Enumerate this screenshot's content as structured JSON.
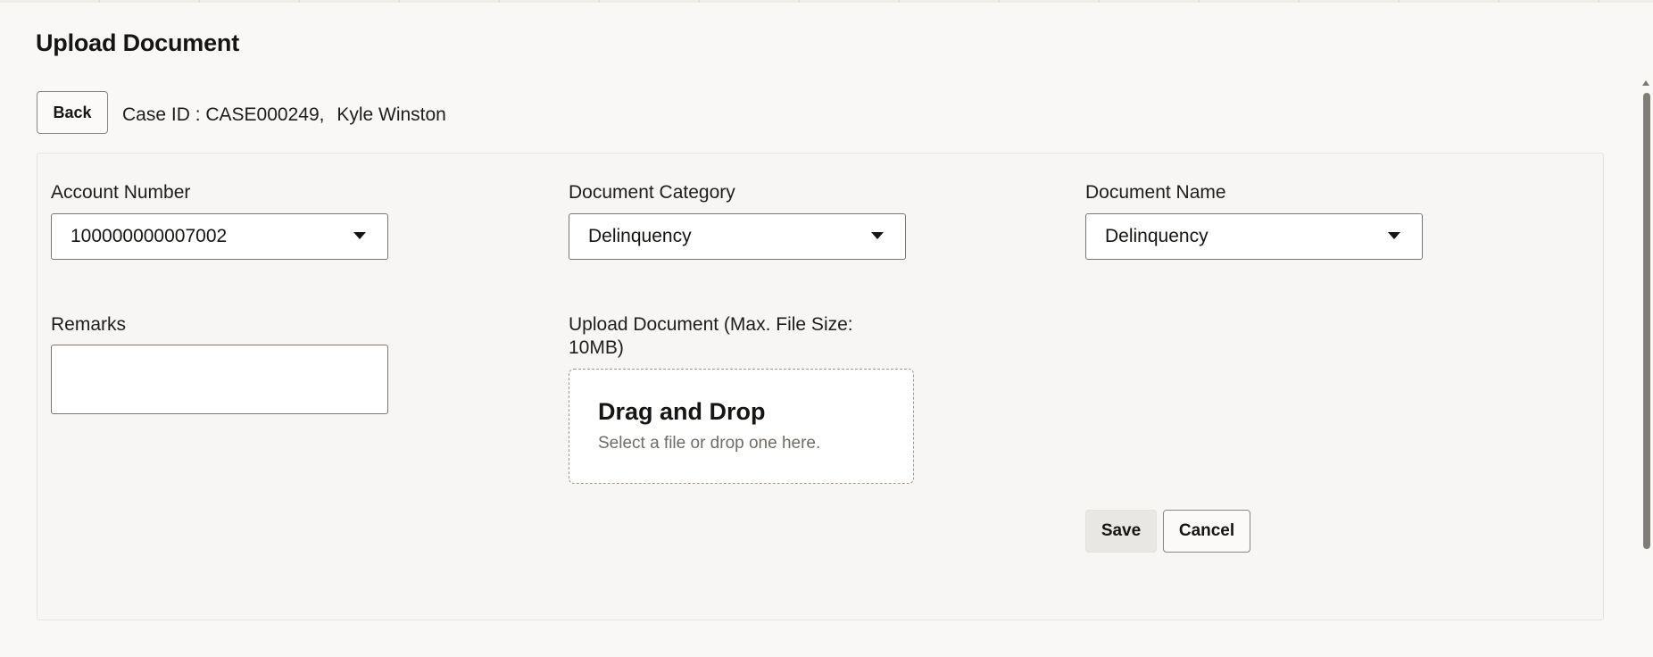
{
  "page": {
    "title": "Upload Document",
    "back_label": "Back",
    "case_id": "Case ID : CASE000249,",
    "customer_name": "Kyle Winston"
  },
  "form": {
    "account_number": {
      "label": "Account Number",
      "value": "100000000007002"
    },
    "document_category": {
      "label": "Document Category",
      "value": "Delinquency"
    },
    "document_name": {
      "label": "Document Name",
      "value": "Delinquency"
    },
    "remarks": {
      "label": "Remarks",
      "value": ""
    },
    "upload": {
      "label_line1": "Upload Document (Max. File Size:",
      "label_line2": "10MB)",
      "dropzone_title": "Drag and Drop",
      "dropzone_hint": "Select a file or drop one here."
    }
  },
  "actions": {
    "save_label": "Save",
    "cancel_label": "Cancel"
  },
  "icons": {
    "dropdown": "chevron-down-icon",
    "scroll_up": "arrow-up-icon"
  },
  "colors": {
    "background": "#f9f8f6",
    "panel": "#f7f6f4",
    "border": "#7a7672",
    "save_background": "#e9e7e4",
    "text": "#161513"
  }
}
